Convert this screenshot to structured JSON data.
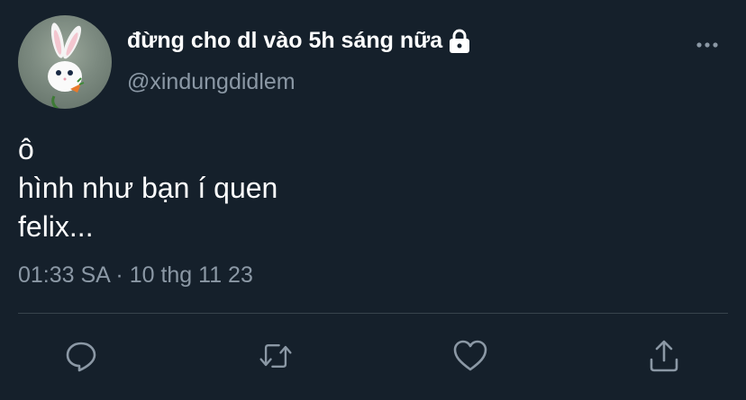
{
  "tweet": {
    "author": {
      "display_name": "đừng cho dl vào 5h sáng nữa",
      "handle": "@xindungdidlem",
      "avatar_icon": "bunny-avatar",
      "protected_icon": "lock-icon"
    },
    "text_lines": [
      "ô",
      "hình như bạn í quen",
      "felix..."
    ],
    "meta": "01:33 SA · 10 thg 11 23"
  },
  "actions": [
    {
      "name": "reply",
      "icon": "reply-icon"
    },
    {
      "name": "retweet",
      "icon": "retweet-icon"
    },
    {
      "name": "like",
      "icon": "heart-icon"
    },
    {
      "name": "share",
      "icon": "share-icon"
    }
  ],
  "colors": {
    "background": "#15202b",
    "text": "#ffffff",
    "secondary": "#8b98a5",
    "divider": "#38444d"
  }
}
